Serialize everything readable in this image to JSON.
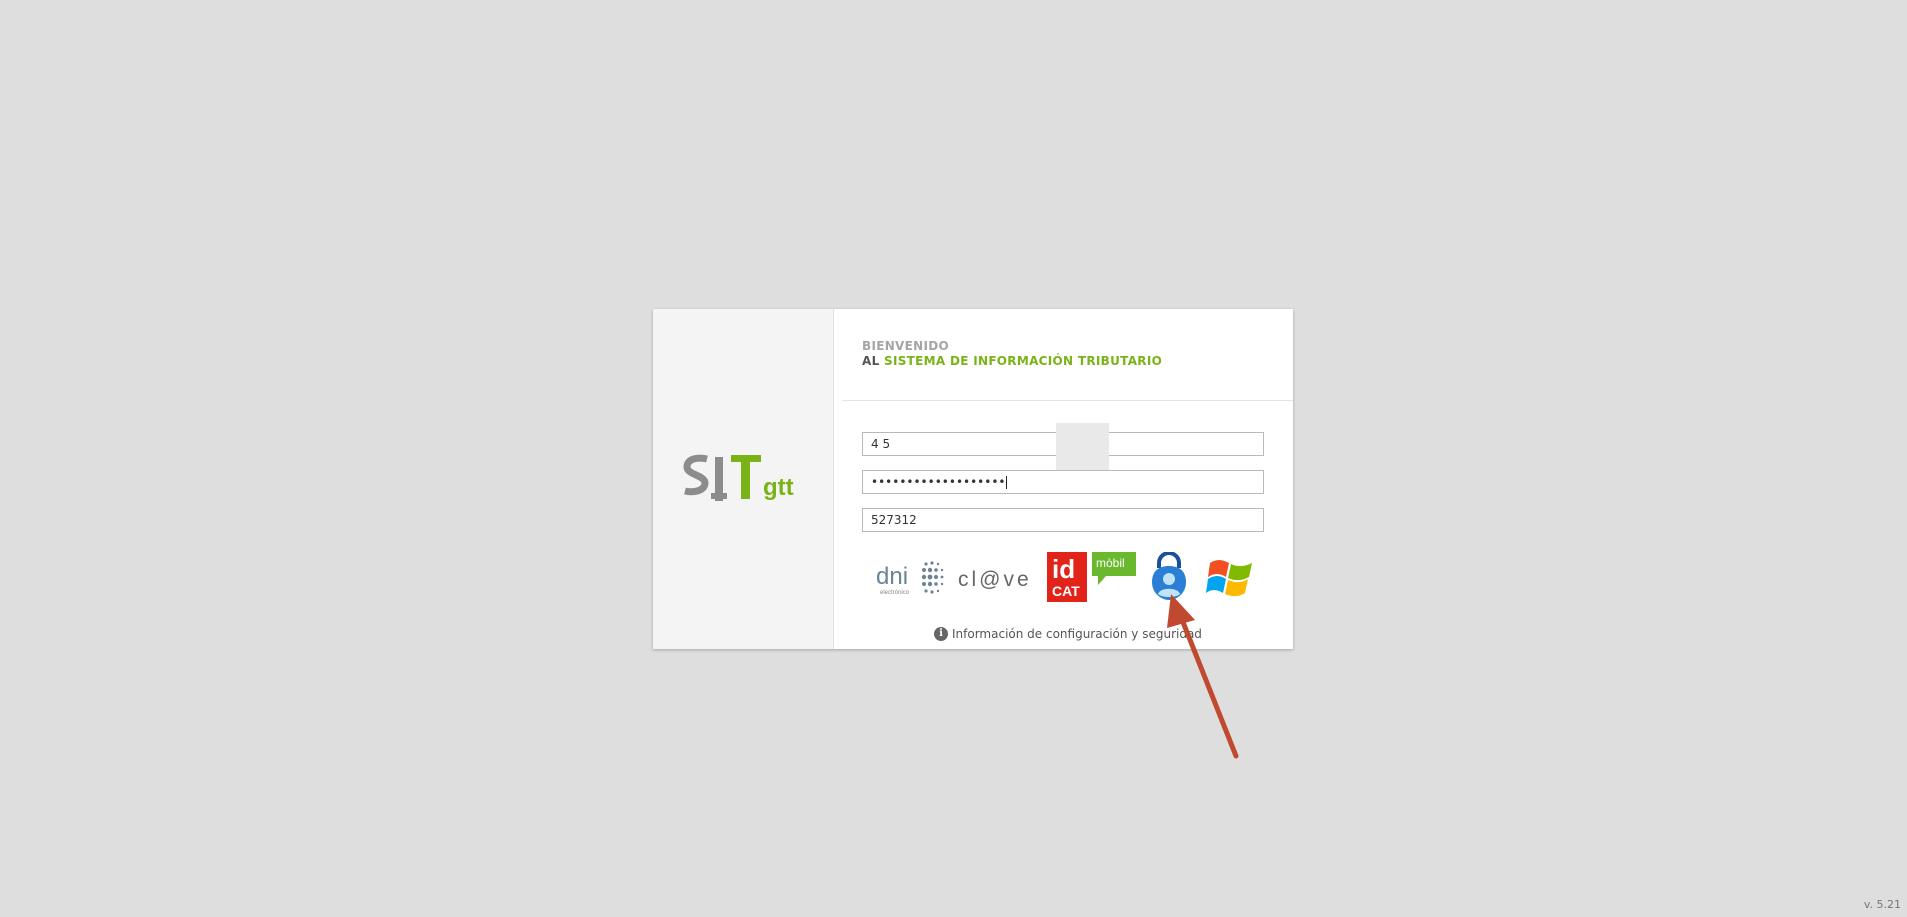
{
  "welcome": {
    "line1": "BIENVENIDO",
    "line2_prefix": "AL",
    "line2_accent": "SISTEMA DE INFORMACIÓN TRIBUTARIO"
  },
  "login": {
    "user_value": "4       5",
    "password_value": "•••••••••••••••••••",
    "code_value": "527312"
  },
  "auth_methods": {
    "dni_label": "dni",
    "dni_sublabel": "electrónico",
    "clave_label": "cl@ve",
    "idcat_line1": "id",
    "idcat_line2": "CAT",
    "mobil_label": "mòbil"
  },
  "info": {
    "text": "Información de configuración y seguridad"
  },
  "logo": {
    "main": "SIT",
    "suffix": "gtt"
  },
  "version": "v. 5.21",
  "colors": {
    "accent": "#7ab317",
    "background": "#dedede",
    "idcat_red": "#e2231a",
    "mobil_green": "#6ab82e",
    "arrow": "#c0492f"
  }
}
